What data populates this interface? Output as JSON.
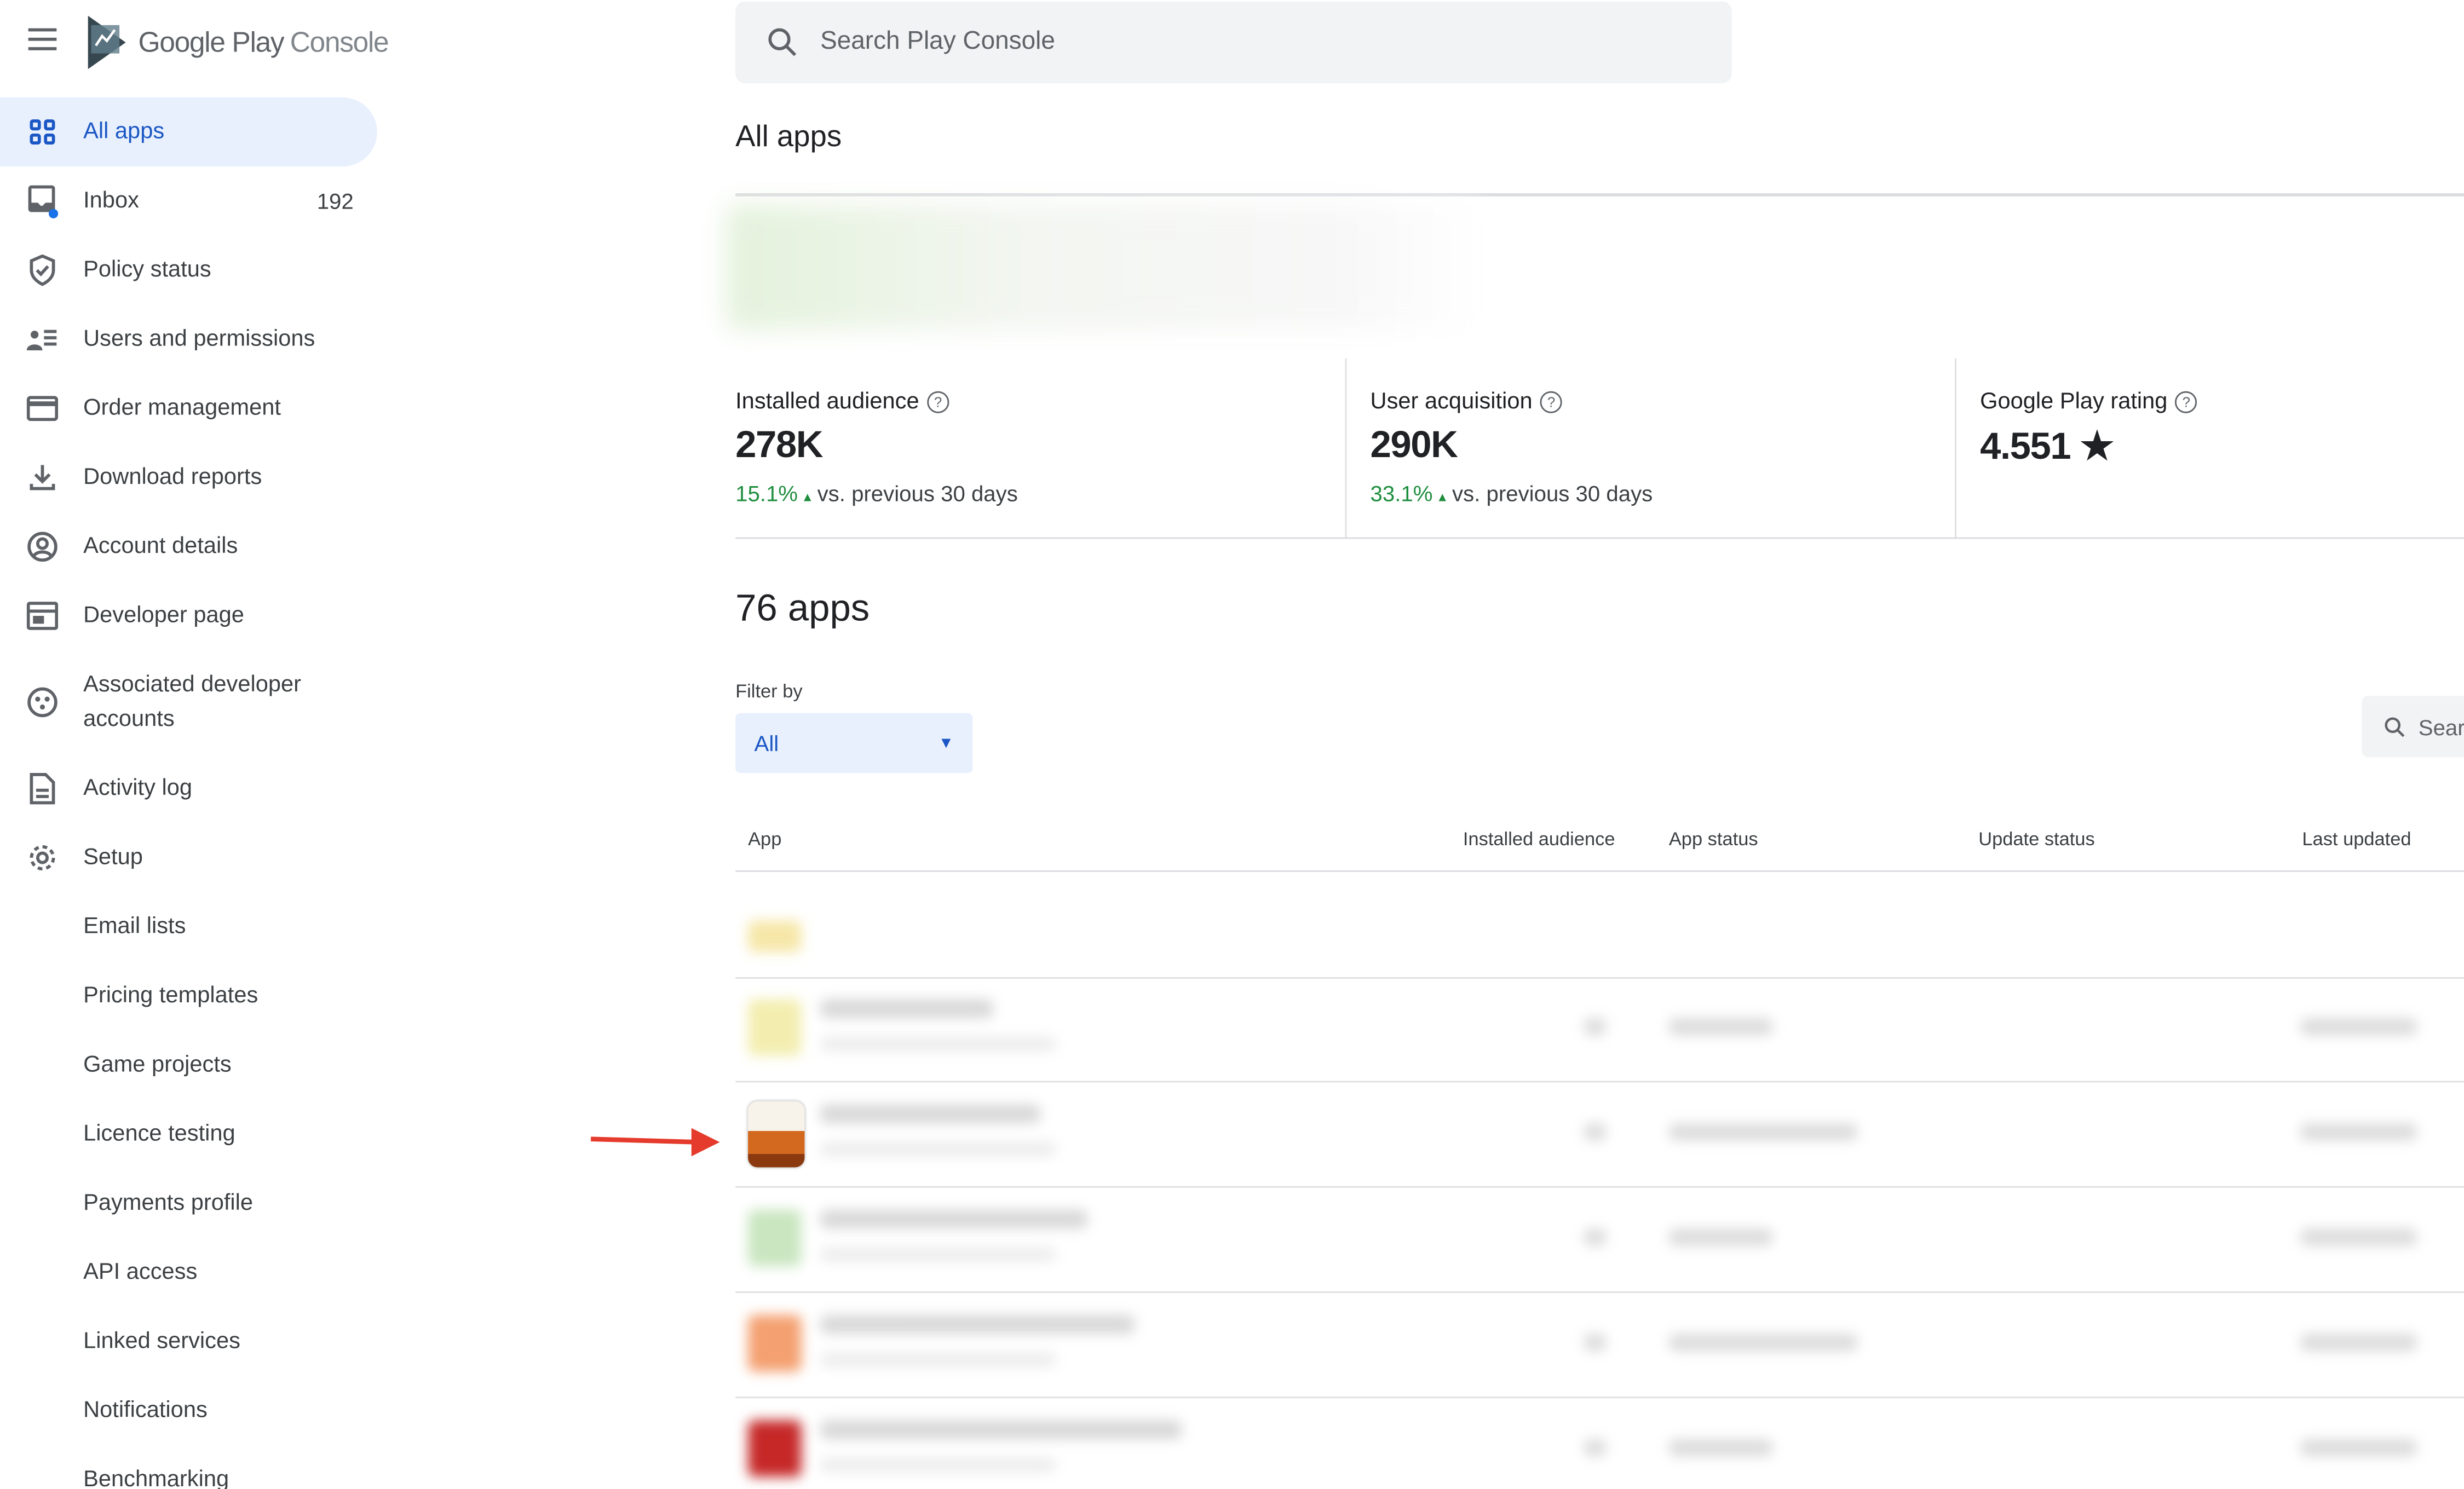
{
  "header": {
    "brand": "Google Play",
    "brand_suffix": "Console",
    "search_placeholder": "Search Play Console"
  },
  "sidebar": {
    "items": [
      {
        "label": "All apps",
        "icon": "grid-icon",
        "active": true
      },
      {
        "label": "Inbox",
        "icon": "inbox-icon",
        "count": "192"
      },
      {
        "label": "Policy status",
        "icon": "shield-check-icon"
      },
      {
        "label": "Users and permissions",
        "icon": "users-icon"
      },
      {
        "label": "Order management",
        "icon": "credit-card-icon"
      },
      {
        "label": "Download reports",
        "icon": "download-icon"
      },
      {
        "label": "Account details",
        "icon": "account-circle-icon"
      },
      {
        "label": "Developer page",
        "icon": "web-page-icon"
      },
      {
        "label": "Associated developer accounts",
        "icon": "linked-accounts-icon"
      },
      {
        "label": "Activity log",
        "icon": "document-icon"
      },
      {
        "label": "Setup",
        "icon": "gear-icon"
      },
      {
        "label": "Email lists"
      },
      {
        "label": "Pricing templates"
      },
      {
        "label": "Game projects"
      },
      {
        "label": "Licence testing"
      },
      {
        "label": "Payments profile"
      },
      {
        "label": "API access"
      },
      {
        "label": "Linked services"
      },
      {
        "label": "Notifications"
      },
      {
        "label": "Benchmarking"
      }
    ]
  },
  "main": {
    "title": "All apps",
    "metrics": [
      {
        "label": "Installed audience",
        "value": "278K",
        "change": "15.1%",
        "change_suffix": "vs. previous 30 days"
      },
      {
        "label": "User acquisition",
        "value": "290K",
        "change": "33.1%",
        "change_suffix": "vs. previous 30 days"
      },
      {
        "label": "Google Play rating",
        "value": "4.551"
      }
    ],
    "apps_count": "76 apps",
    "filter_label": "Filter by",
    "filter_value": "All",
    "table_search_placeholder": "Sear",
    "columns": [
      "App",
      "Installed audience",
      "App status",
      "Update status",
      "Last updated"
    ]
  },
  "colors": {
    "accent": "#1a57c4",
    "active_bg": "#e8f0fe",
    "positive": "#1e8e3e",
    "annotation_arrow": "#e53b2c"
  }
}
